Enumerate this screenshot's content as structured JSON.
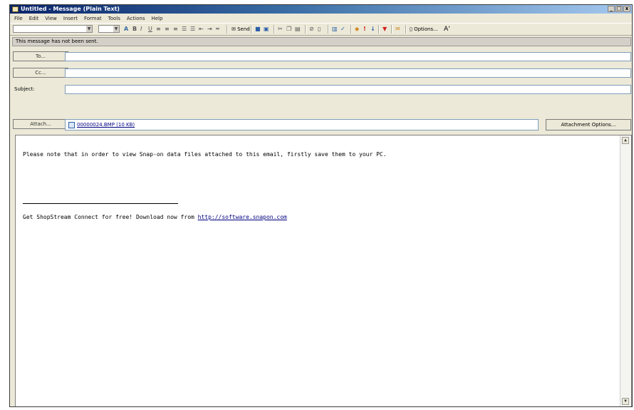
{
  "window": {
    "title": "Untitled - Message (Plain Text)",
    "controls": {
      "minimize": "_",
      "maximize": "□",
      "close": "x"
    }
  },
  "menu": [
    "File",
    "Edit",
    "View",
    "Insert",
    "Format",
    "Tools",
    "Actions",
    "Help"
  ],
  "toolbar": {
    "send_label": "Send",
    "options_label": "Options...",
    "font_size_label": "A'"
  },
  "info_bar": {
    "text": "This message has not been sent."
  },
  "header": {
    "to_label": "To...",
    "to_value": "",
    "cc_label": "Cc...",
    "cc_value": "",
    "subject_label": "Subject:",
    "subject_value": "",
    "attach_label": "Attach...",
    "attachment_name": "00000024.BMP (10 KB)",
    "attachment_options_label": "Attachment Options..."
  },
  "body": {
    "line1": "Please note that in order to view Snap-on data files attached to this email, firstly save them to your PC.",
    "line2_prefix": "Get ShopStream Connect for free! Download now from ",
    "line2_link": "http://software.snapon.com"
  },
  "colors": {
    "title_gradient_start": "#0a246a",
    "title_gradient_end": "#a6caf0",
    "link": "#000080"
  }
}
